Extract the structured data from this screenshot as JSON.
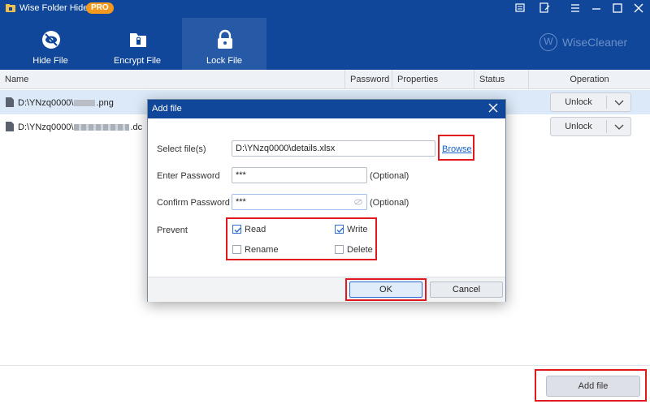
{
  "app": {
    "title": "Wise Folder Hider",
    "badge": "PRO",
    "brand": "WiseCleaner",
    "brand_letter": "W",
    "accent": "#10479a",
    "highlight_color": "#e0191f"
  },
  "window_controls": [
    "message-icon",
    "feedback-icon",
    "menu-icon",
    "minimize-icon",
    "maximize-icon",
    "close-icon"
  ],
  "tabs": [
    {
      "label": "Hide File",
      "icon": "eye-slash-icon",
      "active": false
    },
    {
      "label": "Encrypt File",
      "icon": "folder-lock-icon",
      "active": false
    },
    {
      "label": "Lock File",
      "icon": "lock-icon",
      "active": true
    }
  ],
  "table": {
    "columns": [
      "Name",
      "Password",
      "Properties",
      "Status",
      "Operation"
    ],
    "rows": [
      {
        "name_prefix": "D:\\YNzq0000\\",
        "name_suffix": ".png",
        "action": "Unlock",
        "selected": true
      },
      {
        "name_prefix": "D:\\YNzq0000\\",
        "name_suffix": ".dc",
        "action": "Unlock",
        "selected": false
      }
    ]
  },
  "footer": {
    "add_file": "Add file"
  },
  "dialog": {
    "title": "Add file",
    "select_label": "Select file(s)",
    "select_value": "D:\\YNzq0000\\details.xlsx",
    "browse": "Browse",
    "password_label": "Enter Password",
    "password_value": "***",
    "confirm_label": "Confirm Password",
    "confirm_value": "***",
    "optional": "(Optional)",
    "prevent_label": "Prevent",
    "options": [
      {
        "label": "Read",
        "checked": true
      },
      {
        "label": "Write",
        "checked": true
      },
      {
        "label": "Rename",
        "checked": false
      },
      {
        "label": "Delete",
        "checked": false
      }
    ],
    "ok": "OK",
    "cancel": "Cancel"
  }
}
